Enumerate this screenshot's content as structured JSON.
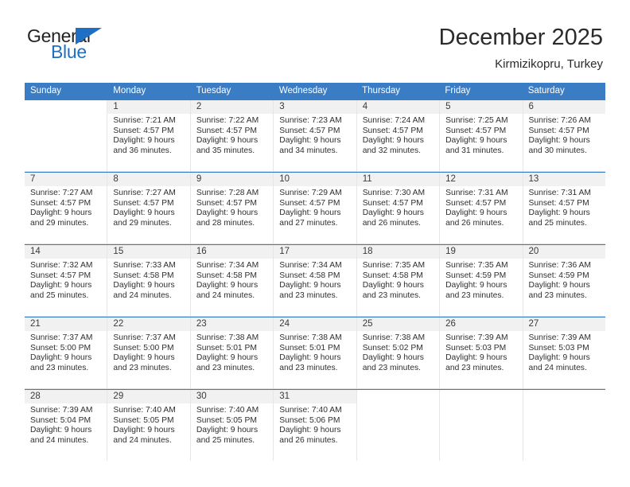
{
  "brand": {
    "name_top": "General",
    "name_bottom": "Blue",
    "flag_icon": "triangle-flag-icon",
    "color_primary": "#1f6fc4",
    "color_text": "#231f20"
  },
  "header": {
    "title": "December 2025",
    "subtitle": "Kirmizikopru, Turkey"
  },
  "calendar": {
    "header_bg": "#3b7dc4",
    "row_rule_color": "#3b7dc4",
    "daynum_bg": "#f1f1f1",
    "weekdays": [
      "Sunday",
      "Monday",
      "Tuesday",
      "Wednesday",
      "Thursday",
      "Friday",
      "Saturday"
    ],
    "weeks": [
      [
        {
          "day": "",
          "lines": []
        },
        {
          "day": "1",
          "lines": [
            "Sunrise: 7:21 AM",
            "Sunset: 4:57 PM",
            "Daylight: 9 hours",
            "and 36 minutes."
          ]
        },
        {
          "day": "2",
          "lines": [
            "Sunrise: 7:22 AM",
            "Sunset: 4:57 PM",
            "Daylight: 9 hours",
            "and 35 minutes."
          ]
        },
        {
          "day": "3",
          "lines": [
            "Sunrise: 7:23 AM",
            "Sunset: 4:57 PM",
            "Daylight: 9 hours",
            "and 34 minutes."
          ]
        },
        {
          "day": "4",
          "lines": [
            "Sunrise: 7:24 AM",
            "Sunset: 4:57 PM",
            "Daylight: 9 hours",
            "and 32 minutes."
          ]
        },
        {
          "day": "5",
          "lines": [
            "Sunrise: 7:25 AM",
            "Sunset: 4:57 PM",
            "Daylight: 9 hours",
            "and 31 minutes."
          ]
        },
        {
          "day": "6",
          "lines": [
            "Sunrise: 7:26 AM",
            "Sunset: 4:57 PM",
            "Daylight: 9 hours",
            "and 30 minutes."
          ]
        }
      ],
      [
        {
          "day": "7",
          "lines": [
            "Sunrise: 7:27 AM",
            "Sunset: 4:57 PM",
            "Daylight: 9 hours",
            "and 29 minutes."
          ]
        },
        {
          "day": "8",
          "lines": [
            "Sunrise: 7:27 AM",
            "Sunset: 4:57 PM",
            "Daylight: 9 hours",
            "and 29 minutes."
          ]
        },
        {
          "day": "9",
          "lines": [
            "Sunrise: 7:28 AM",
            "Sunset: 4:57 PM",
            "Daylight: 9 hours",
            "and 28 minutes."
          ]
        },
        {
          "day": "10",
          "lines": [
            "Sunrise: 7:29 AM",
            "Sunset: 4:57 PM",
            "Daylight: 9 hours",
            "and 27 minutes."
          ]
        },
        {
          "day": "11",
          "lines": [
            "Sunrise: 7:30 AM",
            "Sunset: 4:57 PM",
            "Daylight: 9 hours",
            "and 26 minutes."
          ]
        },
        {
          "day": "12",
          "lines": [
            "Sunrise: 7:31 AM",
            "Sunset: 4:57 PM",
            "Daylight: 9 hours",
            "and 26 minutes."
          ]
        },
        {
          "day": "13",
          "lines": [
            "Sunrise: 7:31 AM",
            "Sunset: 4:57 PM",
            "Daylight: 9 hours",
            "and 25 minutes."
          ]
        }
      ],
      [
        {
          "day": "14",
          "lines": [
            "Sunrise: 7:32 AM",
            "Sunset: 4:57 PM",
            "Daylight: 9 hours",
            "and 25 minutes."
          ]
        },
        {
          "day": "15",
          "lines": [
            "Sunrise: 7:33 AM",
            "Sunset: 4:58 PM",
            "Daylight: 9 hours",
            "and 24 minutes."
          ]
        },
        {
          "day": "16",
          "lines": [
            "Sunrise: 7:34 AM",
            "Sunset: 4:58 PM",
            "Daylight: 9 hours",
            "and 24 minutes."
          ]
        },
        {
          "day": "17",
          "lines": [
            "Sunrise: 7:34 AM",
            "Sunset: 4:58 PM",
            "Daylight: 9 hours",
            "and 23 minutes."
          ]
        },
        {
          "day": "18",
          "lines": [
            "Sunrise: 7:35 AM",
            "Sunset: 4:58 PM",
            "Daylight: 9 hours",
            "and 23 minutes."
          ]
        },
        {
          "day": "19",
          "lines": [
            "Sunrise: 7:35 AM",
            "Sunset: 4:59 PM",
            "Daylight: 9 hours",
            "and 23 minutes."
          ]
        },
        {
          "day": "20",
          "lines": [
            "Sunrise: 7:36 AM",
            "Sunset: 4:59 PM",
            "Daylight: 9 hours",
            "and 23 minutes."
          ]
        }
      ],
      [
        {
          "day": "21",
          "lines": [
            "Sunrise: 7:37 AM",
            "Sunset: 5:00 PM",
            "Daylight: 9 hours",
            "and 23 minutes."
          ]
        },
        {
          "day": "22",
          "lines": [
            "Sunrise: 7:37 AM",
            "Sunset: 5:00 PM",
            "Daylight: 9 hours",
            "and 23 minutes."
          ]
        },
        {
          "day": "23",
          "lines": [
            "Sunrise: 7:38 AM",
            "Sunset: 5:01 PM",
            "Daylight: 9 hours",
            "and 23 minutes."
          ]
        },
        {
          "day": "24",
          "lines": [
            "Sunrise: 7:38 AM",
            "Sunset: 5:01 PM",
            "Daylight: 9 hours",
            "and 23 minutes."
          ]
        },
        {
          "day": "25",
          "lines": [
            "Sunrise: 7:38 AM",
            "Sunset: 5:02 PM",
            "Daylight: 9 hours",
            "and 23 minutes."
          ]
        },
        {
          "day": "26",
          "lines": [
            "Sunrise: 7:39 AM",
            "Sunset: 5:03 PM",
            "Daylight: 9 hours",
            "and 23 minutes."
          ]
        },
        {
          "day": "27",
          "lines": [
            "Sunrise: 7:39 AM",
            "Sunset: 5:03 PM",
            "Daylight: 9 hours",
            "and 24 minutes."
          ]
        }
      ],
      [
        {
          "day": "28",
          "lines": [
            "Sunrise: 7:39 AM",
            "Sunset: 5:04 PM",
            "Daylight: 9 hours",
            "and 24 minutes."
          ]
        },
        {
          "day": "29",
          "lines": [
            "Sunrise: 7:40 AM",
            "Sunset: 5:05 PM",
            "Daylight: 9 hours",
            "and 24 minutes."
          ]
        },
        {
          "day": "30",
          "lines": [
            "Sunrise: 7:40 AM",
            "Sunset: 5:05 PM",
            "Daylight: 9 hours",
            "and 25 minutes."
          ]
        },
        {
          "day": "31",
          "lines": [
            "Sunrise: 7:40 AM",
            "Sunset: 5:06 PM",
            "Daylight: 9 hours",
            "and 26 minutes."
          ]
        },
        {
          "day": "",
          "lines": []
        },
        {
          "day": "",
          "lines": []
        },
        {
          "day": "",
          "lines": []
        }
      ]
    ]
  }
}
